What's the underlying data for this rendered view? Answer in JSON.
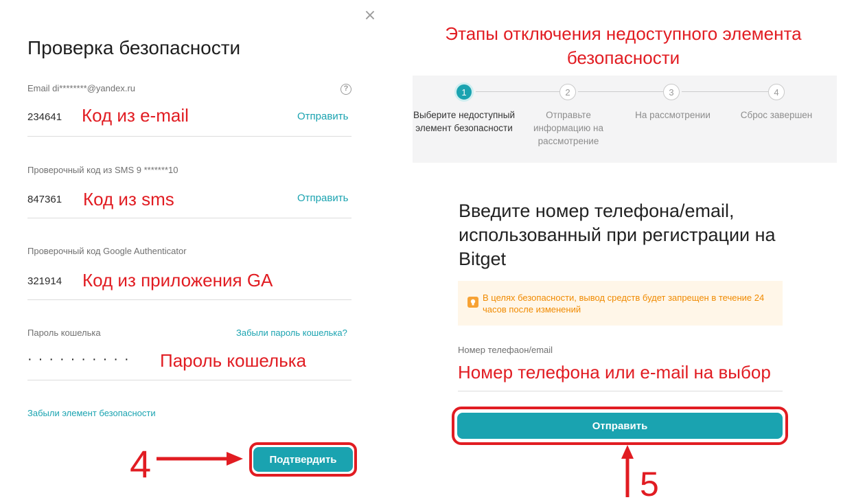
{
  "left": {
    "close_icon": "close-icon",
    "title": "Проверка безопасности",
    "email": {
      "label": "Email di********@yandex.ru",
      "value": "234641",
      "annotation": "Код из e-mail",
      "send": "Отправить"
    },
    "sms": {
      "label": "Проверочный код из SMS 9 *******10",
      "value": "847361",
      "annotation": "Код из sms",
      "send": "Отправить"
    },
    "ga": {
      "label": "Проверочный код Google Authenticator",
      "value": "321914",
      "annotation": "Код из приложения GA"
    },
    "wallet": {
      "label": "Пароль кошелька",
      "forgot": "Забыли пароль кошелька?",
      "value": "··········",
      "annotation": "Пароль кошелька"
    },
    "forgot_element": "Забыли элемент безопасности",
    "confirm": "Подтвердить",
    "step_number": "4"
  },
  "right": {
    "title": "Этапы отключения недоступного элемента безопасности",
    "steps": [
      {
        "num": "1",
        "label": "Выберите недоступный элемент безопасности"
      },
      {
        "num": "2",
        "label": "Отправьте информацию на рассмотрение"
      },
      {
        "num": "3",
        "label": "На рассмотрении"
      },
      {
        "num": "4",
        "label": "Сброс завершен"
      }
    ],
    "heading": "Введите номер телефона/email, использованный при регистрации на Bitget",
    "notice": "В целях безопасности, вывод средств будет запрещен в течение 24 часов после изменений",
    "phone_label": "Номер телефаон/email",
    "phone_annotation": "Номер телефона или e-mail на выбор",
    "send": "Отправить",
    "step_number": "5"
  },
  "colors": {
    "accent": "#1aa3b0",
    "annotation": "#e11c22",
    "notice_bg": "#fff6e8",
    "notice_text": "#f08a00"
  }
}
